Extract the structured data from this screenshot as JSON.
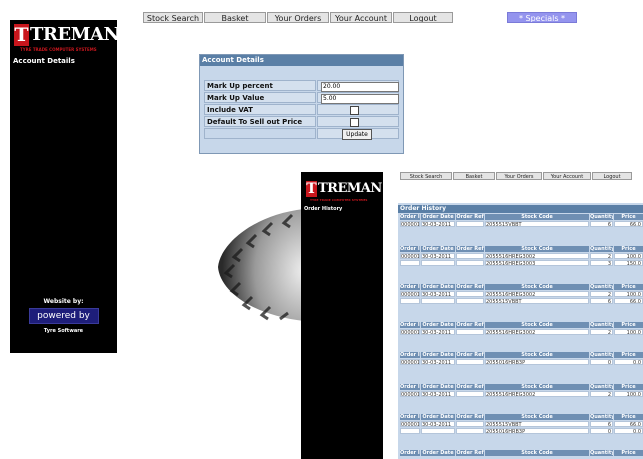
{
  "nav_top": {
    "items": [
      "Stock Search",
      "Basket",
      "Your Orders",
      "Your Account",
      "Logout"
    ],
    "special": "* Specials *"
  },
  "nav_second": {
    "items": [
      "Stock Search",
      "Basket",
      "Your Orders",
      "Your Account",
      "Logout"
    ]
  },
  "logo": {
    "text": "TREMAN",
    "tagline": "TYRE TRADE COMPUTER SYSTEMS"
  },
  "sidebar_top": {
    "title": "Account Details",
    "website_by": "Website by:",
    "powered_by": "powered by",
    "company": "Tyre Software"
  },
  "sidebar_second": {
    "title": "Order History"
  },
  "account_panel": {
    "title": "Account Details",
    "rows": [
      {
        "label": "Mark Up percent",
        "value": "20.00"
      },
      {
        "label": "Mark Up Value",
        "value": "5.00"
      },
      {
        "label": "Include VAT"
      },
      {
        "label": "Default To Sell out Price"
      }
    ],
    "update_label": "Update"
  },
  "order_history": {
    "title": "Order History",
    "headers": [
      "Order ID",
      "Order Date",
      "Order Ref",
      "Stock Code",
      "Quantity",
      "Price"
    ],
    "orders": [
      {
        "id": "00000186",
        "date": "30-03-2011",
        "lines": [
          {
            "code": "2055515VBBT",
            "qty": "6",
            "price": "66.0"
          }
        ]
      },
      {
        "id": "00000185",
        "date": "30-03-2011",
        "lines": [
          {
            "code": "2055516HREG3002",
            "qty": "2",
            "price": "100.0"
          },
          {
            "code": "2055516HREG3003",
            "qty": "3",
            "price": "150.0"
          }
        ]
      },
      {
        "id": "00000184",
        "date": "30-03-2011",
        "lines": [
          {
            "code": "2055516HREG3002",
            "qty": "2",
            "price": "100.0"
          },
          {
            "code": "2055515VBBT",
            "qty": "6",
            "price": "66.0"
          }
        ]
      },
      {
        "id": "00000183",
        "date": "30-03-2011",
        "lines": [
          {
            "code": "2055516HREG3002",
            "qty": "2",
            "price": "100.0"
          }
        ]
      },
      {
        "id": "00000182",
        "date": "30-03-2011",
        "lines": [
          {
            "code": "2055016HRB3P",
            "qty": "0",
            "price": "0.0"
          }
        ]
      },
      {
        "id": "00000181",
        "date": "30-03-2011",
        "lines": [
          {
            "code": "2055516HREG3002",
            "qty": "2",
            "price": "100.0"
          }
        ]
      },
      {
        "id": "00000180",
        "date": "30-03-2011",
        "lines": [
          {
            "code": "2055515VBBT",
            "qty": "6",
            "price": "66.0"
          },
          {
            "code": "2055016HRB3P",
            "qty": "0",
            "price": "0.0"
          }
        ]
      },
      {
        "id": "",
        "date": "",
        "lines": []
      }
    ]
  }
}
